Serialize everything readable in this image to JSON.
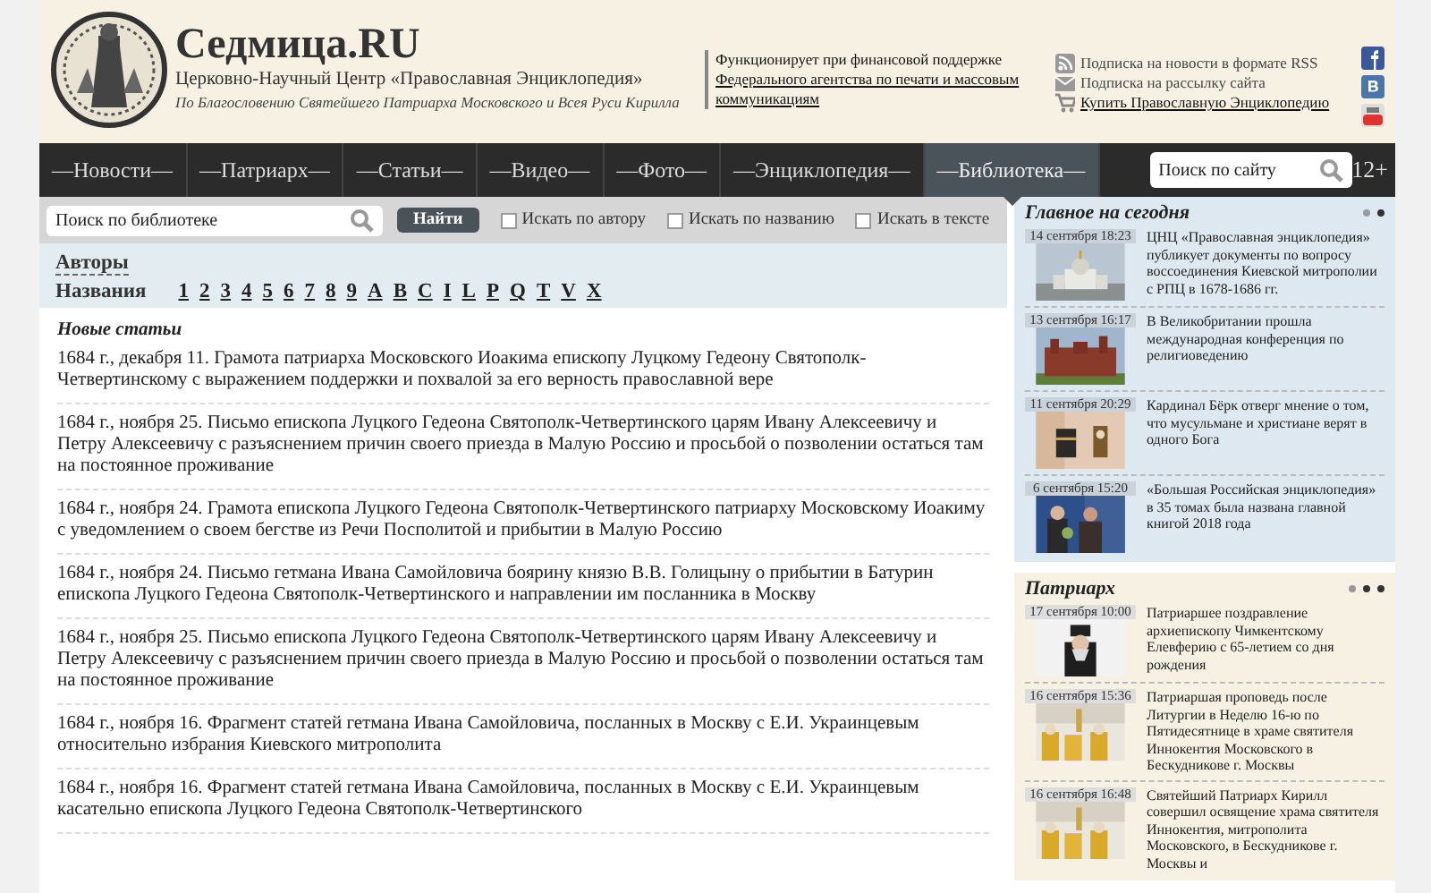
{
  "header": {
    "title": "Седмица.RU",
    "subtitle": "Церковно-Научный Центр «Православная Энциклопедия»",
    "blessing": "По Благословению Святейшего Патриарха Московского и Всея Руси Кирилла",
    "support_text": "Функционирует при финансовой поддержке",
    "support_link": "Федерального агентства по печати и массовым коммуникациям",
    "links": [
      {
        "kind": "rss",
        "label": "Подписка на новости в формате RSS",
        "link": false
      },
      {
        "kind": "mail",
        "label": "Подписка на рассылку сайта",
        "link": false
      },
      {
        "kind": "cart",
        "label": "Купить Православную Энциклопедию",
        "link": true
      }
    ]
  },
  "nav": {
    "items": [
      {
        "label": "—Новости—",
        "selected": false
      },
      {
        "label": "—Патриарх—",
        "selected": false
      },
      {
        "label": "—Статьи—",
        "selected": false
      },
      {
        "label": "—Видео—",
        "selected": false
      },
      {
        "label": "—Фото—",
        "selected": false
      },
      {
        "label": "—Энциклопедия—",
        "selected": false
      },
      {
        "label": "—Библиотека—",
        "selected": true
      }
    ],
    "search_placeholder": "Поиск по сайту",
    "age": "12+"
  },
  "library": {
    "search_placeholder": "Поиск по библиотеке",
    "search_button": "Найти",
    "options": [
      {
        "label": "Искать по автору",
        "checked": false
      },
      {
        "label": "Искать по названию",
        "checked": false
      },
      {
        "label": "Искать в тексте",
        "checked": false
      }
    ],
    "authors_link": "Авторы",
    "titles_label": "Названия",
    "letters": [
      "1",
      "2",
      "3",
      "4",
      "5",
      "6",
      "7",
      "8",
      "9",
      "A",
      "B",
      "C",
      "I",
      "L",
      "P",
      "Q",
      "T",
      "V",
      "X"
    ]
  },
  "articles": {
    "heading": "Новые статьи",
    "items": [
      "1684 г., декабря 11. Грамота патриарха Московского Иоакима епископу Луцкому Гедеону Святополк-Четвертинскому с выражением поддержки и похвалой за его верность православной вере",
      "1684 г., ноября 25. Письмо епископа Луцкого Гедеона Святополк-Четвертинского царям Ивану Алексеевичу и Петру Алексеевичу с разъяснением причин своего приезда в Малую Россию и просьбой о позволении остаться там на постоянное проживание",
      "1684 г., ноября 24. Грамота епископа Луцкого Гедеона Святополк-Четвертинского патриарху Московскому Иоакиму с уведомлением о своем бегстве из Речи Посполитой и прибытии в Малую Россию",
      "1684 г., ноября 24. Письмо гетмана Ивана Самойловича боярину князю В.В. Голицыну о прибытии в Батурин епископа Луцкого Гедеона Святополк-Четвертинского и направлении им посланника в Москву",
      "1684 г., ноября 25. Письмо епископа Луцкого Гедеона Святополк-Четвертинского царям Ивану Алексеевичу и Петру Алексеевичу с разъяснением причин своего приезда в Малую Россию и просьбой о позволении остаться там на постоянное проживание",
      "1684 г., ноября 16. Фрагмент статей гетмана Ивана Самойловича, посланных в Москву с Е.И. Украинцевым относительно избрания Киевского митрополита",
      "1684 г., ноября 16. Фрагмент статей гетмана Ивана Самойловича, посланных в Москву с Е.И. Украинцевым касательно епископа Луцкого Гедеона Святополк-Четвертинского"
    ]
  },
  "sidebar": [
    {
      "kind": "today",
      "title": "Главное на сегодня",
      "dots": [
        {
          "selected": true
        },
        {
          "selected": false
        }
      ],
      "items": [
        {
          "date": "14 сентября 18:23",
          "text": "ЦНЦ «Православная энциклопедия» публикует документы по вопросу воссоединения Киевской митрополии с РПЦ в 1678-1686 гг."
        },
        {
          "date": "13 сентября 16:17",
          "text": "В Великобритании прошла международная конференция по религиоведению"
        },
        {
          "date": "11 сентября 20:29",
          "text": "Кардинал Бёрк отверг мнение о том, что мусульмане и христиане верят в одного Бога"
        },
        {
          "date": "6 сентября 15:20",
          "text": "«Большая Российская энциклопедия» в 35 томах была названа главной книгой 2018 года"
        }
      ]
    },
    {
      "kind": "patriarch",
      "title": "Патриарх",
      "dots": [
        {
          "selected": true
        },
        {
          "selected": false
        },
        {
          "selected": false
        }
      ],
      "items": [
        {
          "date": "17 сентября 10:00",
          "text": "Патриаршее поздравление архиепископу Чимкентскому Елевферию с 65-летием со дня рождения"
        },
        {
          "date": "16 сентября 15:36",
          "text": "Патриаршая проповедь после Литургии в Неделю 16-ю по Пятидесятнице в храме святителя Иннокентия Московского в Бескудникове г. Москвы"
        },
        {
          "date": "16 сентября 16:48",
          "text": "Святейший Патриарх Кирилл совершил освящение храма святителя Иннокентия, митрополита Московского, в Бескудникове г. Москвы и"
        }
      ]
    }
  ]
}
